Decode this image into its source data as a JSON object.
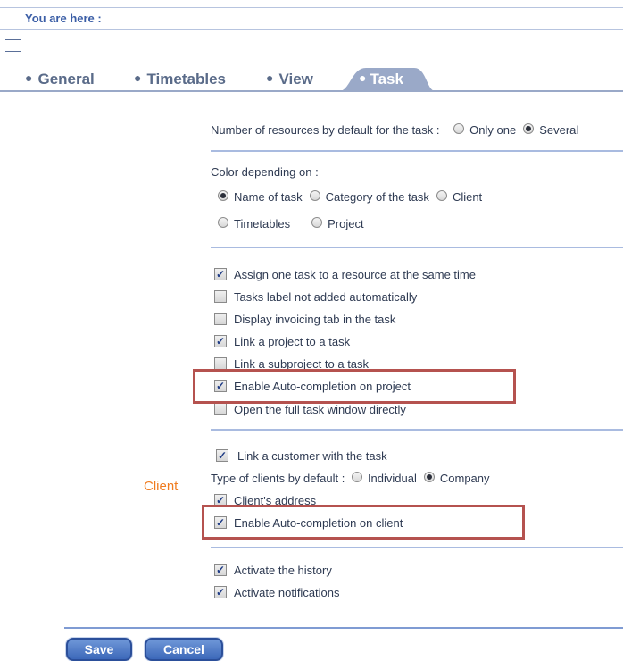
{
  "breadcrumb": {
    "label": "You are here :"
  },
  "tabs": [
    {
      "label": "General",
      "active": false
    },
    {
      "label": "Timetables",
      "active": false
    },
    {
      "label": "View",
      "active": false
    },
    {
      "label": "Task",
      "active": true
    }
  ],
  "resources": {
    "label": "Number of resources by default for the task :",
    "options": [
      {
        "label": "Only one",
        "selected": false
      },
      {
        "label": "Several",
        "selected": true
      }
    ]
  },
  "color": {
    "label": "Color depending on :",
    "options": [
      {
        "label": "Name of task",
        "selected": true
      },
      {
        "label": "Category of the task",
        "selected": false
      },
      {
        "label": "Client",
        "selected": false
      },
      {
        "label": "Timetables",
        "selected": false
      },
      {
        "label": "Project",
        "selected": false
      }
    ]
  },
  "task_options": [
    {
      "label": "Assign one task to a resource at the same time",
      "checked": true
    },
    {
      "label": "Tasks label not added automatically",
      "checked": false
    },
    {
      "label": "Display invoicing tab in the task",
      "checked": false
    },
    {
      "label": "Link a project to a task",
      "checked": true
    },
    {
      "label": "Link a subproject to a task",
      "checked": false
    },
    {
      "label": "Enable Auto-completion on project",
      "checked": true
    },
    {
      "label": "Open the full task window directly",
      "checked": false
    }
  ],
  "client": {
    "section_label": "Client",
    "link_customer": {
      "label": "Link a customer with the task",
      "checked": true
    },
    "type_label": "Type of clients by default :",
    "type_options": [
      {
        "label": "Individual",
        "selected": false
      },
      {
        "label": "Company",
        "selected": true
      }
    ],
    "address": {
      "label": "Client's address",
      "checked": true
    },
    "autocomplete": {
      "label": "Enable Auto-completion on client",
      "checked": true
    }
  },
  "misc_options": [
    {
      "label": "Activate the history",
      "checked": true
    },
    {
      "label": "Activate notifications",
      "checked": true
    }
  ],
  "buttons": {
    "save": "Save",
    "cancel": "Cancel"
  },
  "colors": {
    "accent": "#3c68b9",
    "tab_active": "#9aa9c8",
    "highlight": "#b5524f",
    "client_label": "#f07c20"
  }
}
